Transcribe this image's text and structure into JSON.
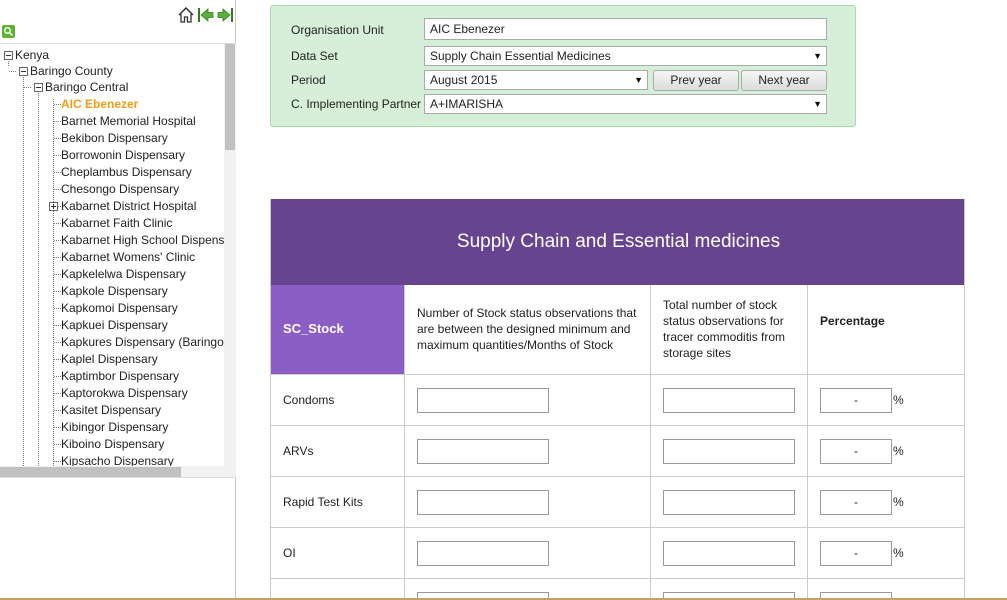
{
  "filters": {
    "org_unit_label": "Organisation Unit",
    "org_unit_value": "AIC Ebenezer",
    "dataset_label": "Data Set",
    "dataset_value": "Supply Chain Essential Medicines",
    "period_label": "Period",
    "period_value": "August 2015",
    "prev_year": "Prev year",
    "next_year": "Next year",
    "partner_label": "C. Implementing Partner",
    "partner_value": "A+IMARISHA"
  },
  "tree": {
    "root": "Kenya",
    "county": "Baringo County",
    "subcounty": "Baringo Central",
    "facilities": [
      "AIC Ebenezer",
      "Barnet Memorial Hospital",
      "Bekibon Dispensary",
      "Borrowonin Dispensary",
      "Cheplambus Dispensary",
      "Chesongo Dispensary",
      "Kabarnet District Hospital",
      "Kabarnet Faith Clinic",
      "Kabarnet High School Dispens",
      "Kabarnet Womens' Clinic",
      "Kapkelelwa Dispensary",
      "Kapkole Dispensary",
      "Kapkomoi Dispensary",
      "Kapkuei Dispensary",
      "Kapkures Dispensary (Baringo",
      "Kaplel Dispensary",
      "Kaptimbor Dispensary",
      "Kaptorokwa Dispensary",
      "Kasitet Dispensary",
      "Kibingor Dispensary",
      "Kiboino Dispensary",
      "Kipsacho Dispensary"
    ]
  },
  "report": {
    "title": "Supply Chain and Essential medicines",
    "header_section": "SC_Stock",
    "col1": "Number of Stock status observations that are  between the designed minimum and maximum quantities/Months of Stock",
    "col2": "Total number of stock status observations for tracer commoditis from storage sites",
    "col3": "Percentage",
    "rows": [
      {
        "label": "Condoms",
        "pct": "-"
      },
      {
        "label": "ARVs",
        "pct": "-"
      },
      {
        "label": "Rapid Test Kits",
        "pct": "-"
      },
      {
        "label": "OI",
        "pct": "-"
      }
    ],
    "pct_symbol": "%"
  }
}
